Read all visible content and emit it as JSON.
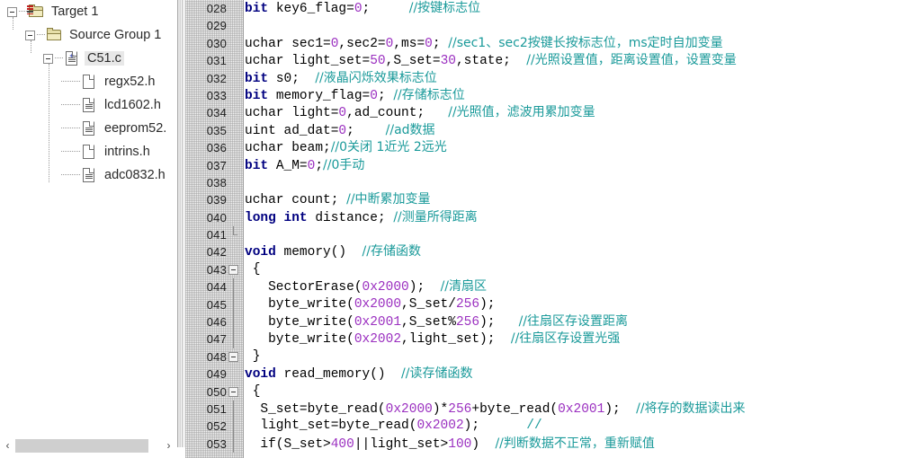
{
  "project_tree": {
    "name": "project-tree",
    "nodes": [
      {
        "label": "Target 1",
        "icon": "folder-target-icon",
        "depth": 0,
        "expander": true,
        "selected": false
      },
      {
        "label": "Source Group 1",
        "icon": "folder-icon",
        "depth": 1,
        "expander": true,
        "selected": false
      },
      {
        "label": "C51.c",
        "icon": "c-source-file-icon",
        "depth": 2,
        "expander": true,
        "selected": true
      },
      {
        "label": "regx52.h",
        "icon": "blank-file-icon",
        "depth": 3,
        "expander": false,
        "selected": false
      },
      {
        "label": "lcd1602.h",
        "icon": "text-file-icon",
        "depth": 3,
        "expander": false,
        "selected": false
      },
      {
        "label": "eeprom52.",
        "icon": "text-file-icon",
        "depth": 3,
        "expander": false,
        "selected": false
      },
      {
        "label": "intrins.h",
        "icon": "blank-file-icon",
        "depth": 3,
        "expander": false,
        "selected": false
      },
      {
        "label": "adc0832.h",
        "icon": "text-file-icon",
        "depth": 3,
        "expander": false,
        "selected": false
      }
    ],
    "hscroll": {
      "left_arrow": "‹",
      "right_arrow": "›"
    }
  },
  "editor": {
    "name": "source-code-editor",
    "first_line_number": 28,
    "lines": [
      {
        "n": "028",
        "fold": "none",
        "tokens": [
          {
            "t": "bit ",
            "c": "kw"
          },
          {
            "t": "key6_flag=",
            "c": "plain"
          },
          {
            "t": "0",
            "c": "num"
          },
          {
            "t": ";     ",
            "c": "plain"
          },
          {
            "t": "//按键标志位",
            "c": "cmt"
          }
        ]
      },
      {
        "n": "029",
        "fold": "none",
        "tokens": []
      },
      {
        "n": "030",
        "fold": "none",
        "tokens": [
          {
            "t": "uchar sec1=",
            "c": "plain"
          },
          {
            "t": "0",
            "c": "num"
          },
          {
            "t": ",sec2=",
            "c": "plain"
          },
          {
            "t": "0",
            "c": "num"
          },
          {
            "t": ",ms=",
            "c": "plain"
          },
          {
            "t": "0",
            "c": "num"
          },
          {
            "t": "; ",
            "c": "plain"
          },
          {
            "t": "//sec1、sec2按键长按标志位，ms定时自加变量",
            "c": "cmt"
          }
        ]
      },
      {
        "n": "031",
        "fold": "none",
        "tokens": [
          {
            "t": "uchar light_set=",
            "c": "plain"
          },
          {
            "t": "50",
            "c": "num"
          },
          {
            "t": ",S_set=",
            "c": "plain"
          },
          {
            "t": "30",
            "c": "num"
          },
          {
            "t": ",state;  ",
            "c": "plain"
          },
          {
            "t": "//光照设置值，距离设置值，设置变量",
            "c": "cmt"
          }
        ]
      },
      {
        "n": "032",
        "fold": "none",
        "tokens": [
          {
            "t": "bit ",
            "c": "kw"
          },
          {
            "t": "s0;  ",
            "c": "plain"
          },
          {
            "t": "//液晶闪烁效果标志位",
            "c": "cmt"
          }
        ]
      },
      {
        "n": "033",
        "fold": "none",
        "tokens": [
          {
            "t": "bit ",
            "c": "kw"
          },
          {
            "t": "memory_flag=",
            "c": "plain"
          },
          {
            "t": "0",
            "c": "num"
          },
          {
            "t": "; ",
            "c": "plain"
          },
          {
            "t": "//存储标志位",
            "c": "cmt"
          }
        ]
      },
      {
        "n": "034",
        "fold": "none",
        "tokens": [
          {
            "t": "uchar light=",
            "c": "plain"
          },
          {
            "t": "0",
            "c": "num"
          },
          {
            "t": ",ad_count;   ",
            "c": "plain"
          },
          {
            "t": "//光照值，滤波用累加变量",
            "c": "cmt"
          }
        ]
      },
      {
        "n": "035",
        "fold": "none",
        "tokens": [
          {
            "t": "uint ad_dat=",
            "c": "plain"
          },
          {
            "t": "0",
            "c": "num"
          },
          {
            "t": ";    ",
            "c": "plain"
          },
          {
            "t": "//ad数据",
            "c": "cmt"
          }
        ]
      },
      {
        "n": "036",
        "fold": "none",
        "tokens": [
          {
            "t": "uchar beam;",
            "c": "plain"
          },
          {
            "t": "//0关闭 1近光 2远光",
            "c": "cmt"
          }
        ]
      },
      {
        "n": "037",
        "fold": "none",
        "tokens": [
          {
            "t": "bit ",
            "c": "kw"
          },
          {
            "t": "A_M=",
            "c": "plain"
          },
          {
            "t": "0",
            "c": "num"
          },
          {
            "t": ";",
            "c": "plain"
          },
          {
            "t": "//0手动",
            "c": "cmt"
          }
        ]
      },
      {
        "n": "038",
        "fold": "none",
        "tokens": []
      },
      {
        "n": "039",
        "fold": "none",
        "tokens": [
          {
            "t": "uchar count; ",
            "c": "plain"
          },
          {
            "t": "//中断累加变量",
            "c": "cmt"
          }
        ]
      },
      {
        "n": "040",
        "fold": "none",
        "tokens": [
          {
            "t": "long int ",
            "c": "kw"
          },
          {
            "t": "distance; ",
            "c": "plain"
          },
          {
            "t": "//测量所得距离",
            "c": "cmt"
          }
        ]
      },
      {
        "n": "041",
        "fold": "endcap",
        "tokens": []
      },
      {
        "n": "042",
        "fold": "none",
        "tokens": [
          {
            "t": "void ",
            "c": "kw"
          },
          {
            "t": "memory()  ",
            "c": "plain"
          },
          {
            "t": "//存储函数",
            "c": "cmt"
          }
        ]
      },
      {
        "n": "043",
        "fold": "box",
        "tokens": [
          {
            "t": " {",
            "c": "plain"
          }
        ]
      },
      {
        "n": "044",
        "fold": "line",
        "tokens": [
          {
            "t": "   SectorErase(",
            "c": "plain"
          },
          {
            "t": "0x2000",
            "c": "num"
          },
          {
            "t": ");  ",
            "c": "plain"
          },
          {
            "t": "//清扇区",
            "c": "cmt"
          }
        ]
      },
      {
        "n": "045",
        "fold": "line",
        "tokens": [
          {
            "t": "   byte_write(",
            "c": "plain"
          },
          {
            "t": "0x2000",
            "c": "num"
          },
          {
            "t": ",S_set/",
            "c": "plain"
          },
          {
            "t": "256",
            "c": "num"
          },
          {
            "t": ");",
            "c": "plain"
          }
        ]
      },
      {
        "n": "046",
        "fold": "line",
        "tokens": [
          {
            "t": "   byte_write(",
            "c": "plain"
          },
          {
            "t": "0x2001",
            "c": "num"
          },
          {
            "t": ",S_set%",
            "c": "plain"
          },
          {
            "t": "256",
            "c": "num"
          },
          {
            "t": ");   ",
            "c": "plain"
          },
          {
            "t": "//往扇区存设置距离",
            "c": "cmt"
          }
        ]
      },
      {
        "n": "047",
        "fold": "line",
        "tokens": [
          {
            "t": "   byte_write(",
            "c": "plain"
          },
          {
            "t": "0x2002",
            "c": "num"
          },
          {
            "t": ",light_set);  ",
            "c": "plain"
          },
          {
            "t": "//往扇区存设置光强",
            "c": "cmt"
          }
        ]
      },
      {
        "n": "048",
        "fold": "box",
        "tokens": [
          {
            "t": " }",
            "c": "plain"
          }
        ]
      },
      {
        "n": "049",
        "fold": "none",
        "tokens": [
          {
            "t": "void ",
            "c": "kw"
          },
          {
            "t": "read_memory()  ",
            "c": "plain"
          },
          {
            "t": "//读存储函数",
            "c": "cmt"
          }
        ]
      },
      {
        "n": "050",
        "fold": "box",
        "tokens": [
          {
            "t": " {",
            "c": "plain"
          }
        ]
      },
      {
        "n": "051",
        "fold": "line",
        "tokens": [
          {
            "t": "  S_set=byte_read(",
            "c": "plain"
          },
          {
            "t": "0x2000",
            "c": "num"
          },
          {
            "t": ")*",
            "c": "plain"
          },
          {
            "t": "256",
            "c": "num"
          },
          {
            "t": "+byte_read(",
            "c": "plain"
          },
          {
            "t": "0x2001",
            "c": "num"
          },
          {
            "t": ");  ",
            "c": "plain"
          },
          {
            "t": "//将存的数据读出来",
            "c": "cmt"
          }
        ]
      },
      {
        "n": "052",
        "fold": "line",
        "tokens": [
          {
            "t": "  light_set=byte_read(",
            "c": "plain"
          },
          {
            "t": "0x2002",
            "c": "num"
          },
          {
            "t": ");      ",
            "c": "plain"
          },
          {
            "t": "//",
            "c": "cmt"
          }
        ]
      },
      {
        "n": "053",
        "fold": "line",
        "tokens": [
          {
            "t": "  if(S_set>",
            "c": "plain"
          },
          {
            "t": "400",
            "c": "num"
          },
          {
            "t": "||light_set>",
            "c": "plain"
          },
          {
            "t": "100",
            "c": "num"
          },
          {
            "t": ")  ",
            "c": "plain"
          },
          {
            "t": "//判断数据不正常，重新赋值",
            "c": "cmt"
          }
        ]
      }
    ]
  },
  "colors": {
    "keyword": "#000080",
    "number": "#9b30c0",
    "comment": "#1a9a9a",
    "gutter_bg": "#f2f2f2",
    "selection_bg": "#e8e8e8"
  }
}
